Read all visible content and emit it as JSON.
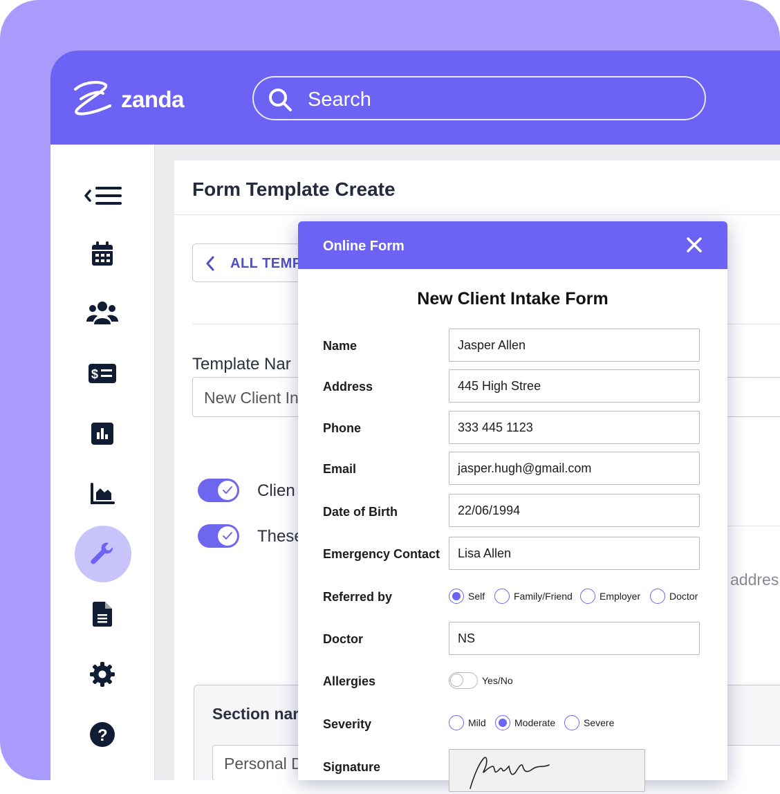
{
  "brand": {
    "name": "zanda",
    "color": "#6c63f4",
    "accent_bg": "#a89bfb"
  },
  "search": {
    "placeholder": "Search"
  },
  "sidebar": {
    "items": [
      {
        "icon": "collapse-menu-icon"
      },
      {
        "icon": "calendar-icon"
      },
      {
        "icon": "clients-icon"
      },
      {
        "icon": "billing-icon"
      },
      {
        "icon": "reports-icon"
      },
      {
        "icon": "analytics-icon"
      },
      {
        "icon": "wrench-icon",
        "active": true
      },
      {
        "icon": "document-icon"
      },
      {
        "icon": "gear-icon"
      },
      {
        "icon": "help-icon"
      }
    ]
  },
  "page": {
    "title": "Form Template Create",
    "back_label": "ALL TEMP",
    "template_name_label": "Template Nar",
    "template_name_value": "New Client In",
    "toggle_1_label": "Clien",
    "toggle_2_label": "These",
    "address_hint": "addres",
    "section_label": "Section nar",
    "section_value": "Personal D"
  },
  "modal": {
    "title": "Online Form",
    "form_title": "New Client Intake Form",
    "fields": [
      {
        "label": "Name",
        "value": "Jasper Allen"
      },
      {
        "label": "Address",
        "value": "445 High Stree"
      },
      {
        "label": "Phone",
        "value": "333 445 1123"
      },
      {
        "label": "Email",
        "value": "jasper.hugh@gmail.com"
      },
      {
        "label": "Date of Birth",
        "value": "22/06/1994"
      },
      {
        "label": "Emergency Contact",
        "value": "Lisa Allen"
      }
    ],
    "referred_by": {
      "label": "Referred by",
      "options": [
        "Self",
        "Family/Friend",
        "Employer",
        "Doctor"
      ],
      "selected": "Self"
    },
    "doctor": {
      "label": "Doctor",
      "value": "NS"
    },
    "allergies": {
      "label": "Allergies",
      "toggle_label": "Yes/No",
      "on": false
    },
    "severity": {
      "label": "Severity",
      "options": [
        "Mild",
        "Moderate",
        "Severe"
      ],
      "selected": "Moderate"
    },
    "signature": {
      "label": "Signature"
    }
  }
}
